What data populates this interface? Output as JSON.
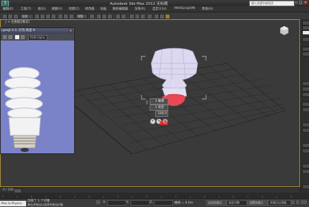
{
  "app": {
    "title": "Autodesk 3ds Max  2012    无标题",
    "icon_letter": "3",
    "search_placeholder": "键入关键字或短语",
    "window_controls": [
      "—",
      "□",
      "✕"
    ]
  },
  "menu": {
    "items": [
      "编辑(E)",
      "工具(T)",
      "组(G)",
      "视图(V)",
      "创建(C)",
      "修改器",
      "动画",
      "图形编辑器",
      "渲染(R)",
      "自定义(U)",
      "MAXScript(M)",
      "帮助(H)"
    ]
  },
  "toolbar": {
    "selection_filter": "全部",
    "coord_system": "视图"
  },
  "viewport": {
    "label": "[ + ][透视][真实]",
    "cube_icon": "viewcube-icon"
  },
  "photo_window": {
    "title": "(.jpeg) 1:2, 灯泡 类型 8",
    "channel": "RGB Alpha"
  },
  "quad_menu": {
    "top_label": "1 概要",
    "second_label": "1 指定",
    "third_label": "100.0",
    "annotation": "截面"
  },
  "timeline": {
    "text": "0 / 100"
  },
  "status": {
    "maxscript": "Max to Physics",
    "selected": "选择了 1 个对象",
    "hint": "单击并拖动以选择并移动对象",
    "x_label": "X:",
    "x_value": "",
    "y_label": "Y:",
    "z_label": "Z:",
    "grid": "栅格 = 0.0m",
    "auto_key": "自动关键点",
    "selected_set": "选定对象",
    "set_key": "设置关键点",
    "key_filter": "关键点过滤器..."
  },
  "colors": {
    "accent_red": "#ff2b2b",
    "viewport_bg": "#3a3a3a",
    "photo_bg": "#7a82c8"
  }
}
